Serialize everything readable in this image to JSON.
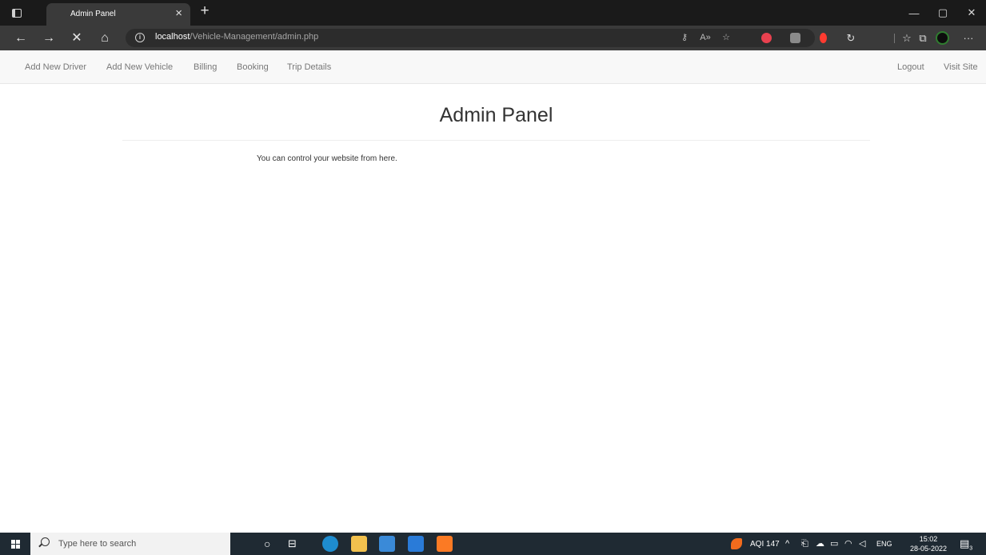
{
  "browser": {
    "tab": {
      "title": "Admin Panel",
      "close_glyph": "×"
    },
    "new_tab_glyph": "+",
    "window_controls": {
      "minimize": "—",
      "restore": "▢",
      "close": "✕"
    },
    "nav": {
      "back": "←",
      "forward": "→",
      "stop": "✕",
      "home": "⌂"
    },
    "url": {
      "host": "localhost",
      "path": "/Vehicle-Management/admin.php"
    },
    "more_glyph": "···"
  },
  "site_nav": {
    "left_links": [
      {
        "label": "Add New Driver"
      },
      {
        "label": "Add New Vehicle"
      },
      {
        "label": "Billing"
      },
      {
        "label": "Booking"
      },
      {
        "label": "Trip Details"
      }
    ],
    "right_links": [
      {
        "label": "Logout"
      },
      {
        "label": "Visit Site"
      }
    ]
  },
  "main": {
    "title": "Admin Panel",
    "intro": "You can control your website from here."
  },
  "taskbar": {
    "search_placeholder": "Type here to search",
    "aqi": "AQI 147",
    "language": "ENG",
    "time": "15:02",
    "date": "28-05-2022",
    "notification_count": "3"
  },
  "colors": {
    "navbar_bg": "#f8f8f8",
    "nav_link": "#777777",
    "title_text": "#333333",
    "browser_chrome": "#3a3a3a",
    "taskbar_bg": "#1f2a33"
  }
}
